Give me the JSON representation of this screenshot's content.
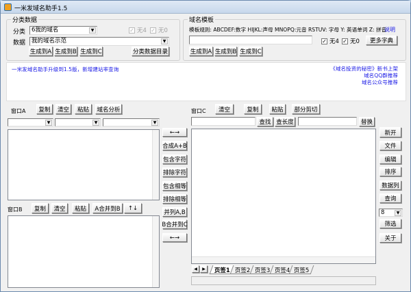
{
  "title": "一米发域名助手1.5",
  "category_group": {
    "legend": "分类数据",
    "category_label": "分类",
    "category_value": "6我的域名",
    "data_label": "数据",
    "data_value": "我的域名示范",
    "no4_label": "无4",
    "no0_label": "无0",
    "buttons": [
      "生成到A",
      "生成到B",
      "生成到C"
    ],
    "catalog_button": "分类数据目录"
  },
  "template_group": {
    "legend": "域名模板",
    "rules": "模板规则: ABCDEF:数字 HIJKL:声母 MNOPQ:元音 RSTUV: 字母 Y: 英语单词 Z: 拼音",
    "help_link": "说明",
    "input_value": "",
    "no4_label": "无4",
    "no0_label": "无0",
    "more_dict": "更多字典",
    "buttons": [
      "生成到A",
      "生成到B",
      "生成到C"
    ]
  },
  "notice": {
    "left": "一米发域名助手升级到1.5版，新增建站率查询",
    "right": [
      "《域名投资的秘密》新书上架",
      "域名QQ群推荐",
      "域名公众号推荐"
    ],
    "link_color": "#1a1ae6"
  },
  "window_a": {
    "label": "窗口A",
    "buttons": [
      "复制",
      "清空",
      "粘贴",
      "域名分析"
    ]
  },
  "window_b": {
    "label": "窗口B",
    "buttons": [
      "复制",
      "清空",
      "粘贴",
      "A合并到B",
      "↑↓"
    ]
  },
  "middle_buttons": [
    "←→",
    "合成A+B",
    "包含字符",
    "排除字符",
    "包含相等",
    "排除相等",
    "并列A,B",
    "B合并到C",
    "←→"
  ],
  "window_c": {
    "label": "窗口C",
    "buttons": [
      "清空",
      "复制",
      "粘贴",
      "部分剪切"
    ],
    "find": "查找",
    "find_length": "查长度",
    "replace": "替换",
    "tabs": [
      "页签1",
      "页签2",
      "页签3",
      "页签4",
      "页签5"
    ],
    "active_tab": "页签1"
  },
  "right_buttons": {
    "new": "新开",
    "file": "文件",
    "edit": "编辑",
    "sort": "排序",
    "columns": "数据列",
    "query": "查询",
    "select_value": "8",
    "filter": "筛选",
    "about": "关于"
  }
}
